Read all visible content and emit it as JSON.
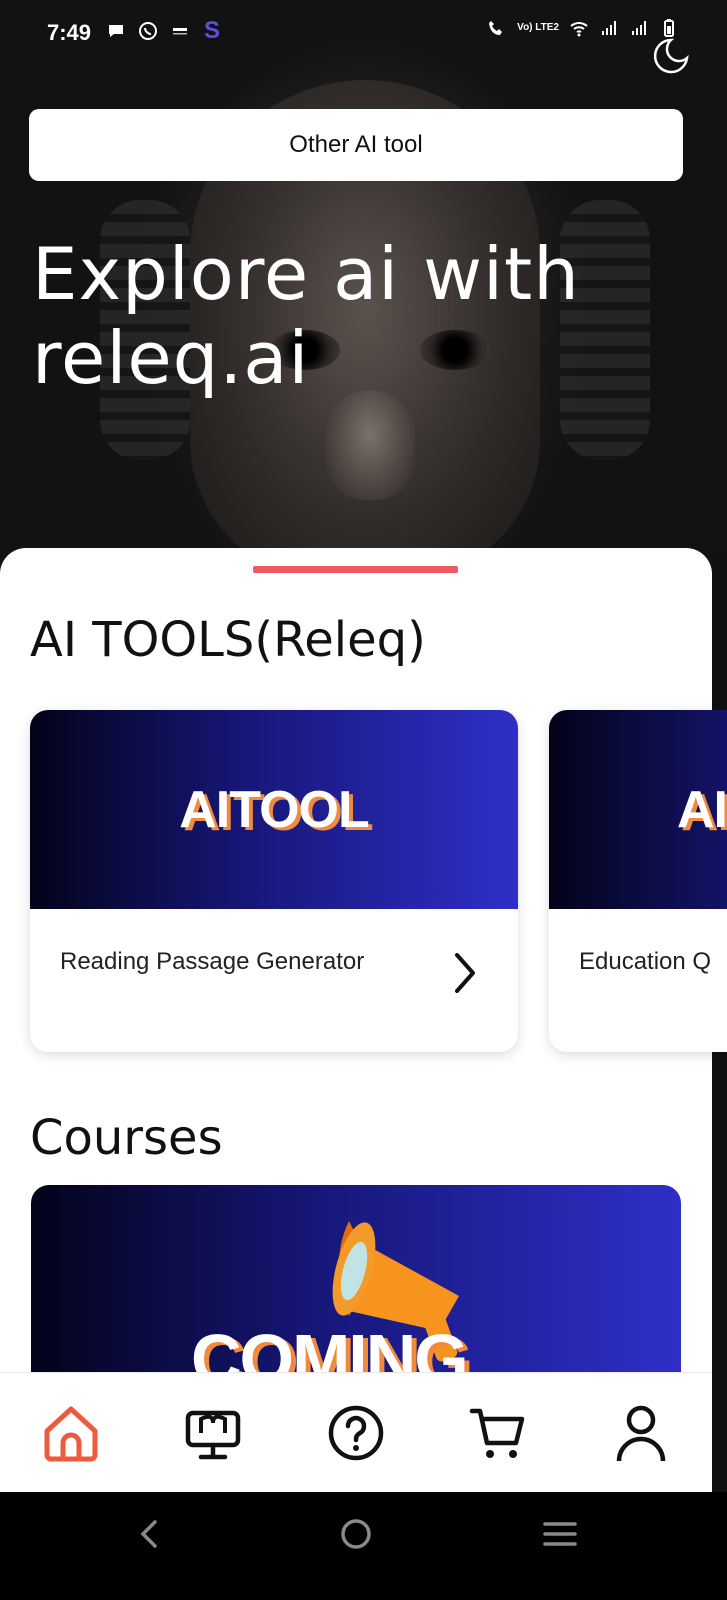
{
  "status_bar": {
    "time": "7:49",
    "network_label": "Vo) LTE2"
  },
  "hero": {
    "other_tool_button": "Other AI tool",
    "title": "Explore ai with releq.ai"
  },
  "ai_tools": {
    "section_title": "AI TOOLS(Releq)",
    "cards": [
      {
        "banner": "AITOOL",
        "label": "Reading Passage Generator"
      },
      {
        "banner": "AITOOL",
        "label": "Education Q"
      }
    ]
  },
  "courses": {
    "section_title": "Courses",
    "banner_text": "COMING"
  },
  "bottom_nav": {
    "items": [
      {
        "icon": "home-icon",
        "active": true
      },
      {
        "icon": "courses-icon",
        "active": false
      },
      {
        "icon": "help-icon",
        "active": false
      },
      {
        "icon": "cart-icon",
        "active": false
      },
      {
        "icon": "profile-icon",
        "active": false
      }
    ]
  },
  "colors": {
    "accent": "#ee5a63",
    "home_active": "#ef5a3c",
    "banner_start": "#03031a",
    "banner_end": "#2f2fc8",
    "banner_shadow": "#f08a3e"
  }
}
